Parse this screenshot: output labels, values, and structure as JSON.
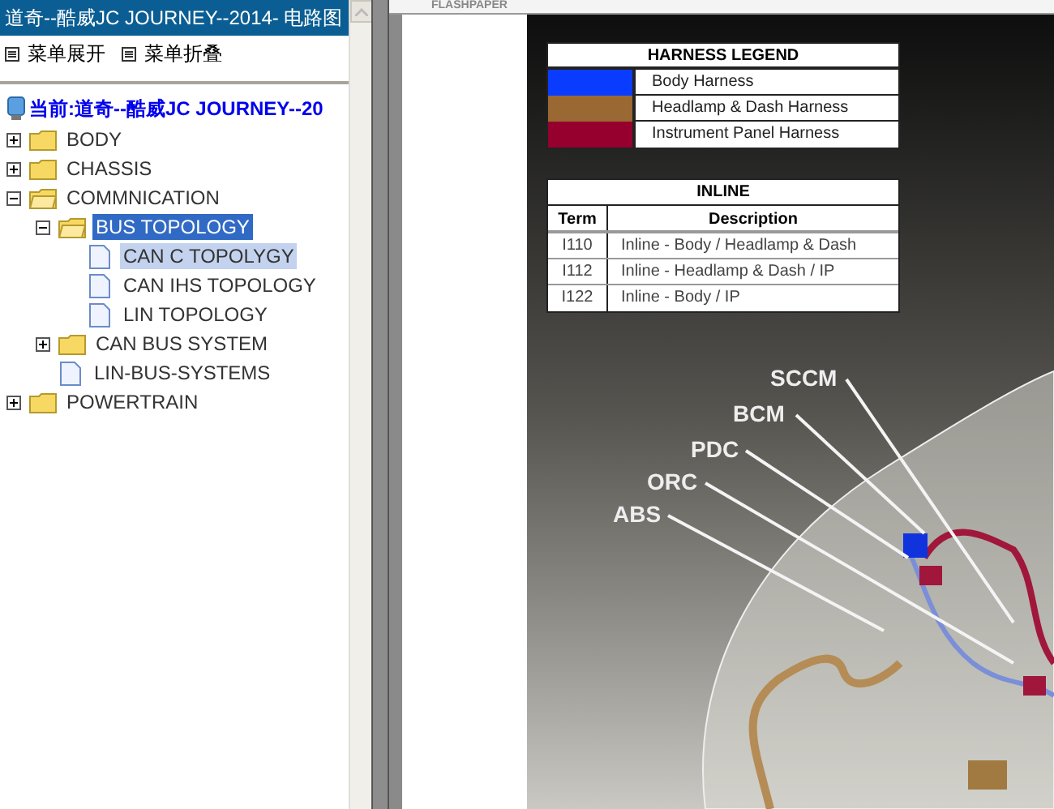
{
  "window": {
    "title": "道奇--酷威JC JOURNEY--2014- 电路图"
  },
  "menu_actions": [
    {
      "label": "菜单展开"
    },
    {
      "label": "菜单折叠"
    }
  ],
  "tree": {
    "header": "当前:道奇--酷威JC JOURNEY--20",
    "items": [
      {
        "kind": "folder",
        "label": "BODY",
        "expanded": false,
        "selected": false,
        "hovered": false
      },
      {
        "kind": "folder",
        "label": "CHASSIS",
        "expanded": false,
        "selected": false,
        "hovered": false
      },
      {
        "kind": "folder",
        "label": "COMMNICATION",
        "expanded": true,
        "selected": false,
        "hovered": false,
        "children": [
          {
            "kind": "folder",
            "label": "BUS TOPOLOGY",
            "expanded": true,
            "selected": true,
            "hovered": false,
            "children": [
              {
                "kind": "document",
                "label": "CAN C TOPOLYGY",
                "selected": false,
                "hovered": true
              },
              {
                "kind": "document",
                "label": "CAN IHS TOPOLOGY",
                "selected": false,
                "hovered": false
              },
              {
                "kind": "document",
                "label": "LIN TOPOLOGY",
                "selected": false,
                "hovered": false
              }
            ]
          },
          {
            "kind": "folder",
            "label": "CAN BUS SYSTEM",
            "expanded": false,
            "selected": false,
            "hovered": false
          },
          {
            "kind": "document",
            "label": "LIN-BUS-SYSTEMS",
            "selected": false,
            "hovered": false
          }
        ]
      },
      {
        "kind": "folder",
        "label": "POWERTRAIN",
        "expanded": false,
        "selected": false,
        "hovered": false
      }
    ]
  },
  "viewer": {
    "toolbar_label": "FLASHPAPER",
    "harness_legend": {
      "title": "HARNESS LEGEND",
      "entries": [
        {
          "label": "Body Harness",
          "color": "#0a3cff"
        },
        {
          "label": "Headlamp & Dash Harness",
          "color": "#9a6832"
        },
        {
          "label": "Instrument Panel Harness",
          "color": "#96002e"
        }
      ]
    },
    "inline_table": {
      "title": "INLINE",
      "columns": [
        "Term",
        "Description"
      ],
      "rows": [
        [
          "I110",
          "Inline - Body / Headlamp & Dash"
        ],
        [
          "I112",
          "Inline - Headlamp & Dash / IP"
        ],
        [
          "I122",
          "Inline - Body / IP"
        ]
      ]
    },
    "callouts": [
      "SCCM",
      "BCM",
      "PDC",
      "ORC",
      "ABS"
    ]
  }
}
